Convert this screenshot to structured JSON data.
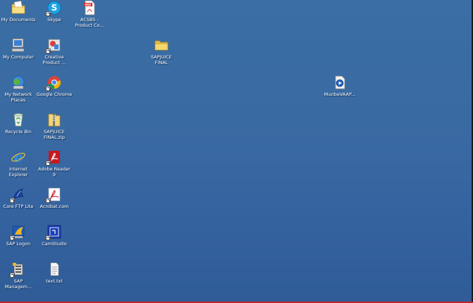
{
  "desktop": {
    "icons": [
      {
        "label": "My Documents"
      },
      {
        "label": "Skype"
      },
      {
        "label": "ACSBS -\nProduct Co..."
      },
      {
        "label": "My Computer"
      },
      {
        "label": "Creative\nProduct ..."
      },
      {
        "label": "SAPJUICE\nFINAL"
      },
      {
        "label": "My Network\nPlaces"
      },
      {
        "label": "Google Chrome"
      },
      {
        "label": "MunbeVAAP..."
      },
      {
        "label": "Recycle Bin"
      },
      {
        "label": "SAPJUICE\nFINAL.zip"
      },
      {
        "label": "Internet\nExplorer"
      },
      {
        "label": "Adobe Reader\n9"
      },
      {
        "label": "Core FTP Lite"
      },
      {
        "label": "Acrobat.com"
      },
      {
        "label": "SAP Logon"
      },
      {
        "label": "CamStudio"
      },
      {
        "label": "SAP\nManagem..."
      },
      {
        "label": "text.txt"
      }
    ]
  },
  "colors": {
    "desktop_background": "#3a6ea5",
    "label_text": "#ffffff"
  }
}
